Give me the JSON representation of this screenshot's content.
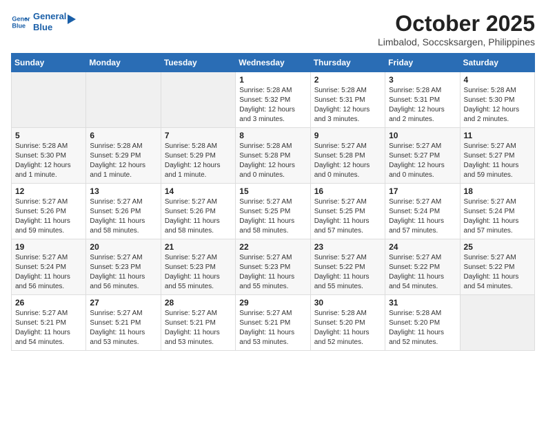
{
  "logo": {
    "line1": "General",
    "line2": "Blue"
  },
  "title": "October 2025",
  "location": "Limbalod, Soccsksargen, Philippines",
  "weekdays": [
    "Sunday",
    "Monday",
    "Tuesday",
    "Wednesday",
    "Thursday",
    "Friday",
    "Saturday"
  ],
  "weeks": [
    [
      {
        "day": "",
        "detail": ""
      },
      {
        "day": "",
        "detail": ""
      },
      {
        "day": "",
        "detail": ""
      },
      {
        "day": "1",
        "detail": "Sunrise: 5:28 AM\nSunset: 5:32 PM\nDaylight: 12 hours\nand 3 minutes."
      },
      {
        "day": "2",
        "detail": "Sunrise: 5:28 AM\nSunset: 5:31 PM\nDaylight: 12 hours\nand 3 minutes."
      },
      {
        "day": "3",
        "detail": "Sunrise: 5:28 AM\nSunset: 5:31 PM\nDaylight: 12 hours\nand 2 minutes."
      },
      {
        "day": "4",
        "detail": "Sunrise: 5:28 AM\nSunset: 5:30 PM\nDaylight: 12 hours\nand 2 minutes."
      }
    ],
    [
      {
        "day": "5",
        "detail": "Sunrise: 5:28 AM\nSunset: 5:30 PM\nDaylight: 12 hours\nand 1 minute."
      },
      {
        "day": "6",
        "detail": "Sunrise: 5:28 AM\nSunset: 5:29 PM\nDaylight: 12 hours\nand 1 minute."
      },
      {
        "day": "7",
        "detail": "Sunrise: 5:28 AM\nSunset: 5:29 PM\nDaylight: 12 hours\nand 1 minute."
      },
      {
        "day": "8",
        "detail": "Sunrise: 5:28 AM\nSunset: 5:28 PM\nDaylight: 12 hours\nand 0 minutes."
      },
      {
        "day": "9",
        "detail": "Sunrise: 5:27 AM\nSunset: 5:28 PM\nDaylight: 12 hours\nand 0 minutes."
      },
      {
        "day": "10",
        "detail": "Sunrise: 5:27 AM\nSunset: 5:27 PM\nDaylight: 12 hours\nand 0 minutes."
      },
      {
        "day": "11",
        "detail": "Sunrise: 5:27 AM\nSunset: 5:27 PM\nDaylight: 11 hours\nand 59 minutes."
      }
    ],
    [
      {
        "day": "12",
        "detail": "Sunrise: 5:27 AM\nSunset: 5:26 PM\nDaylight: 11 hours\nand 59 minutes."
      },
      {
        "day": "13",
        "detail": "Sunrise: 5:27 AM\nSunset: 5:26 PM\nDaylight: 11 hours\nand 58 minutes."
      },
      {
        "day": "14",
        "detail": "Sunrise: 5:27 AM\nSunset: 5:26 PM\nDaylight: 11 hours\nand 58 minutes."
      },
      {
        "day": "15",
        "detail": "Sunrise: 5:27 AM\nSunset: 5:25 PM\nDaylight: 11 hours\nand 58 minutes."
      },
      {
        "day": "16",
        "detail": "Sunrise: 5:27 AM\nSunset: 5:25 PM\nDaylight: 11 hours\nand 57 minutes."
      },
      {
        "day": "17",
        "detail": "Sunrise: 5:27 AM\nSunset: 5:24 PM\nDaylight: 11 hours\nand 57 minutes."
      },
      {
        "day": "18",
        "detail": "Sunrise: 5:27 AM\nSunset: 5:24 PM\nDaylight: 11 hours\nand 57 minutes."
      }
    ],
    [
      {
        "day": "19",
        "detail": "Sunrise: 5:27 AM\nSunset: 5:24 PM\nDaylight: 11 hours\nand 56 minutes."
      },
      {
        "day": "20",
        "detail": "Sunrise: 5:27 AM\nSunset: 5:23 PM\nDaylight: 11 hours\nand 56 minutes."
      },
      {
        "day": "21",
        "detail": "Sunrise: 5:27 AM\nSunset: 5:23 PM\nDaylight: 11 hours\nand 55 minutes."
      },
      {
        "day": "22",
        "detail": "Sunrise: 5:27 AM\nSunset: 5:23 PM\nDaylight: 11 hours\nand 55 minutes."
      },
      {
        "day": "23",
        "detail": "Sunrise: 5:27 AM\nSunset: 5:22 PM\nDaylight: 11 hours\nand 55 minutes."
      },
      {
        "day": "24",
        "detail": "Sunrise: 5:27 AM\nSunset: 5:22 PM\nDaylight: 11 hours\nand 54 minutes."
      },
      {
        "day": "25",
        "detail": "Sunrise: 5:27 AM\nSunset: 5:22 PM\nDaylight: 11 hours\nand 54 minutes."
      }
    ],
    [
      {
        "day": "26",
        "detail": "Sunrise: 5:27 AM\nSunset: 5:21 PM\nDaylight: 11 hours\nand 54 minutes."
      },
      {
        "day": "27",
        "detail": "Sunrise: 5:27 AM\nSunset: 5:21 PM\nDaylight: 11 hours\nand 53 minutes."
      },
      {
        "day": "28",
        "detail": "Sunrise: 5:27 AM\nSunset: 5:21 PM\nDaylight: 11 hours\nand 53 minutes."
      },
      {
        "day": "29",
        "detail": "Sunrise: 5:27 AM\nSunset: 5:21 PM\nDaylight: 11 hours\nand 53 minutes."
      },
      {
        "day": "30",
        "detail": "Sunrise: 5:28 AM\nSunset: 5:20 PM\nDaylight: 11 hours\nand 52 minutes."
      },
      {
        "day": "31",
        "detail": "Sunrise: 5:28 AM\nSunset: 5:20 PM\nDaylight: 11 hours\nand 52 minutes."
      },
      {
        "day": "",
        "detail": ""
      }
    ]
  ]
}
